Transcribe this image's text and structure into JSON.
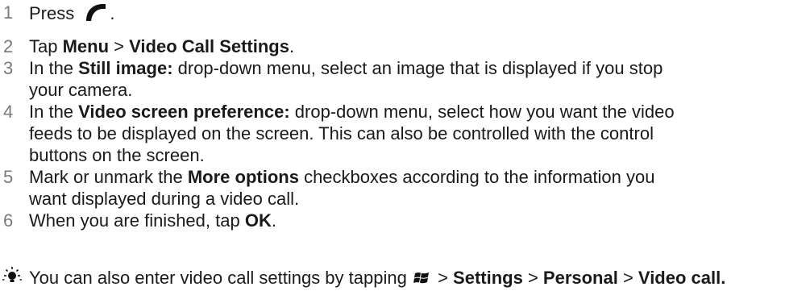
{
  "steps": [
    {
      "num": "1",
      "lines": [
        [
          "Press "
        ],
        [
          ". "
        ]
      ]
    },
    {
      "num": "2",
      "lines": []
    },
    {
      "num": "3",
      "lines": []
    },
    {
      "num": "4",
      "lines": []
    },
    {
      "num": "5",
      "lines": []
    },
    {
      "num": "6",
      "lines": []
    }
  ],
  "s1": {
    "num": "1",
    "pre": "Press",
    "post": "."
  },
  "s2": {
    "num": "2",
    "pre": "Tap ",
    "b1": "Menu",
    "mid": " > ",
    "b2": "Video Call Settings",
    "post": "."
  },
  "s3": {
    "num": "3",
    "pre": "In the ",
    "b1": "Still image:",
    "post": " drop-down menu, select an image that is displayed if you stop",
    "line2": "your camera."
  },
  "s4": {
    "num": "4",
    "pre": "In the ",
    "b1": "Video screen preference:",
    "post": " drop-down menu, select how you want the video",
    "line2": "feeds to be displayed on the screen. This can also be controlled with the control",
    "line3": "buttons on the screen."
  },
  "s5": {
    "num": "5",
    "pre": "Mark or unmark the ",
    "b1": "More options",
    "post": " checkboxes according to the information you",
    "line2": "want displayed during a video call."
  },
  "s6": {
    "num": "6",
    "pre": "When you are finished, tap ",
    "b1": "OK",
    "post": "."
  },
  "tip": {
    "pre": "You can also enter video call settings by tapping ",
    "sep1": " > ",
    "b1": "Settings",
    "sep2": " > ",
    "b2": "Personal",
    "sep3": " > ",
    "b3": "Video call",
    "post": "."
  },
  "icons": {
    "step1": "phone-icon",
    "tip": "lightbulb-icon",
    "start": "windows-start-icon"
  },
  "colors": {
    "text": "#1a1a1a",
    "number": "#7a7a7a"
  }
}
